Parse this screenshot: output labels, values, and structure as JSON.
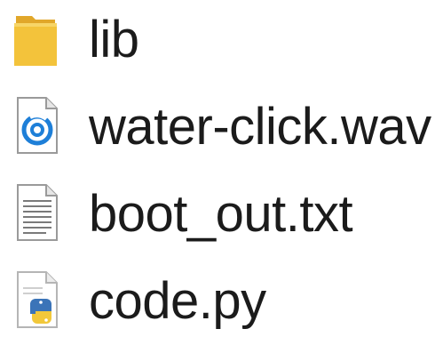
{
  "files": [
    {
      "name": "lib",
      "icon": "folder-icon"
    },
    {
      "name": "water-click.wav",
      "icon": "audio-file-icon"
    },
    {
      "name": "boot_out.txt",
      "icon": "text-file-icon"
    },
    {
      "name": "code.py",
      "icon": "python-file-icon"
    }
  ],
  "colors": {
    "folder": "#f3c33b",
    "folder_dark": "#e1a72a",
    "audio_ring": "#1e7fd8",
    "python_blue": "#3b74b8",
    "python_yellow": "#f2c83a",
    "text": "#1b1b1b"
  }
}
